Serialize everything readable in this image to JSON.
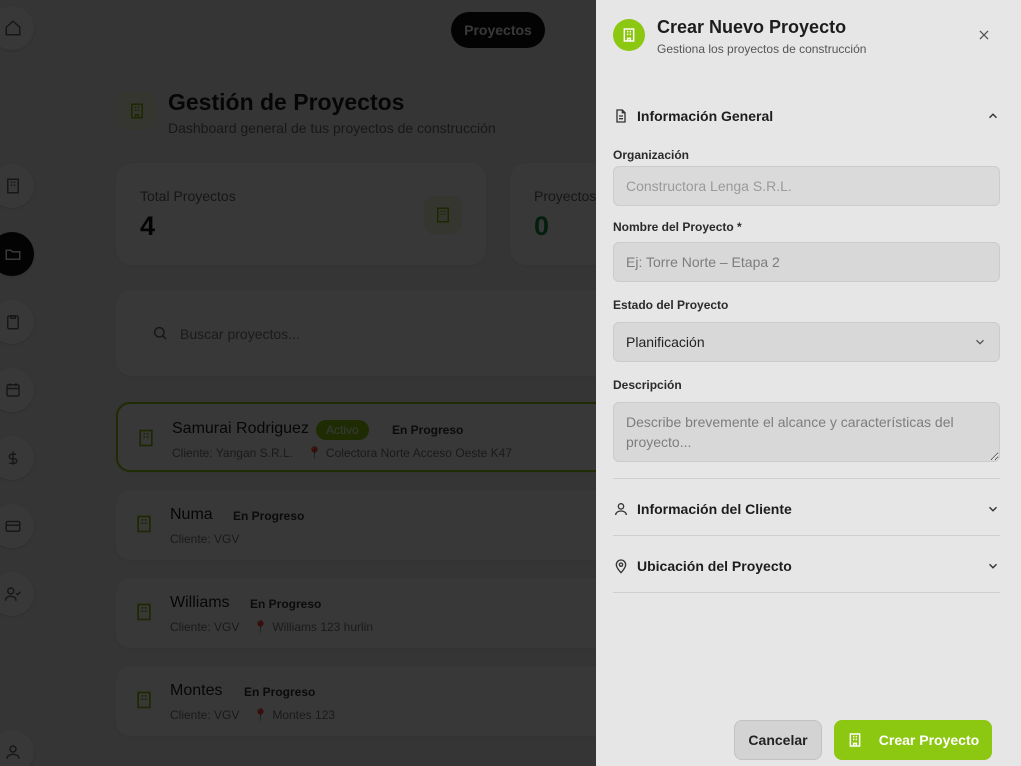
{
  "app": {
    "top_pill": "Proyectos",
    "page_title": "Gestión de Proyectos",
    "page_subtitle": "Dashboard general de tus proyectos de construcción",
    "stats": [
      {
        "label": "Total Proyectos",
        "value": "4"
      },
      {
        "label": "Proyectos",
        "value": "0"
      }
    ],
    "search_placeholder": "Buscar proyectos...",
    "projects": [
      {
        "name": "Samurai Rodriguez",
        "badge": "Activo",
        "status": "En Progreso",
        "client": "Cliente: Yangan S.R.L.",
        "location": "Colectora Norte Acceso Oeste K47"
      },
      {
        "name": "Numa",
        "status": "En Progreso",
        "client": "Cliente: VGV",
        "location": ""
      },
      {
        "name": "Williams",
        "status": "En Progreso",
        "client": "Cliente: VGV",
        "location": "Williams 123 hurlin"
      },
      {
        "name": "Montes",
        "status": "En Progreso",
        "client": "Cliente: VGV",
        "location": "Montes 123"
      }
    ]
  },
  "panel": {
    "title": "Crear Nuevo Proyecto",
    "subtitle": "Gestiona los proyectos de construcción",
    "section_general": "Información General",
    "org_label": "Organización",
    "org_value": "Constructora Lenga S.R.L.",
    "name_label": "Nombre del Proyecto *",
    "name_placeholder": "Ej: Torre Norte – Etapa 2",
    "status_label": "Estado del Proyecto",
    "status_value": "Planificación",
    "desc_label": "Descripción",
    "desc_placeholder": "Describe brevemente el alcance y características del proyecto...",
    "section_client": "Información del Cliente",
    "section_location": "Ubicación del Proyecto",
    "cancel_label": "Cancelar",
    "create_label": "Crear Proyecto"
  },
  "colors": {
    "accent": "#8cc711",
    "overlay": "rgba(0,0,0,0.78)"
  }
}
